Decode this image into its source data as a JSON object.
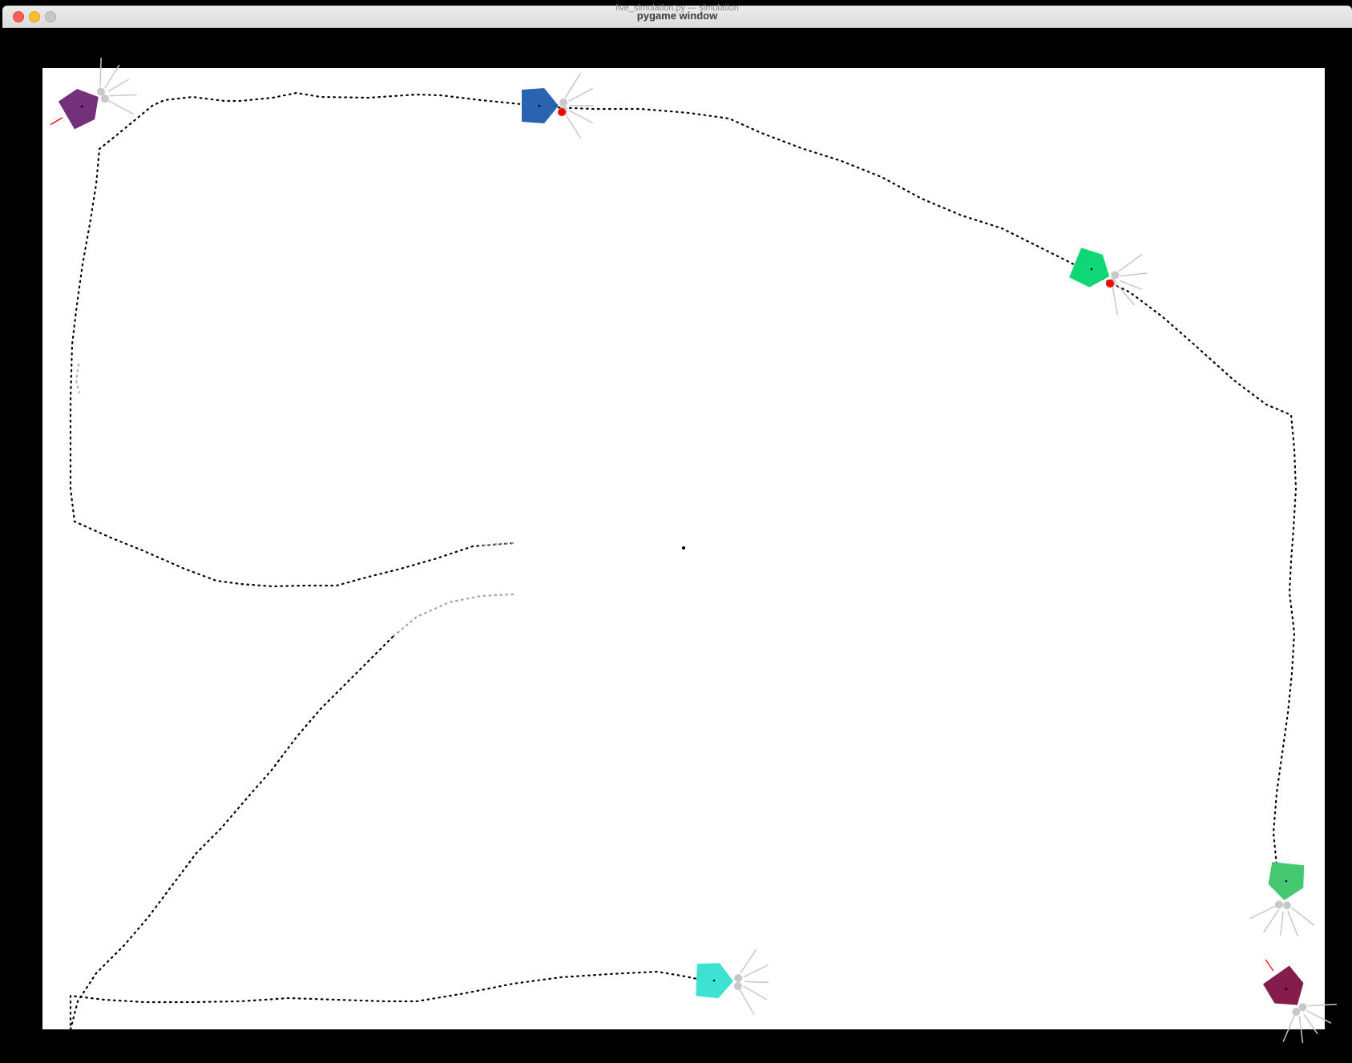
{
  "window": {
    "background_title": "live_simulation.py — simulation",
    "title": "pygame window",
    "controls": [
      "close",
      "minimize",
      "zoom"
    ]
  },
  "simulation": {
    "arena_color": "#ffffff",
    "border_color": "#000000",
    "trail_color": "#000000",
    "faded_trail_color": "#999999",
    "whisker_color": "#c8c8c8",
    "contact_color": "#ff0000",
    "robots": [
      {
        "name": "purple",
        "color": "#74307a"
      },
      {
        "name": "blue",
        "color": "#2a63b0"
      },
      {
        "name": "green",
        "color": "#0fd775"
      },
      {
        "name": "mint-green",
        "color": "#45c870"
      },
      {
        "name": "cyan",
        "color": "#3ee2d3"
      },
      {
        "name": "maroon",
        "color": "#841c4c"
      }
    ]
  }
}
